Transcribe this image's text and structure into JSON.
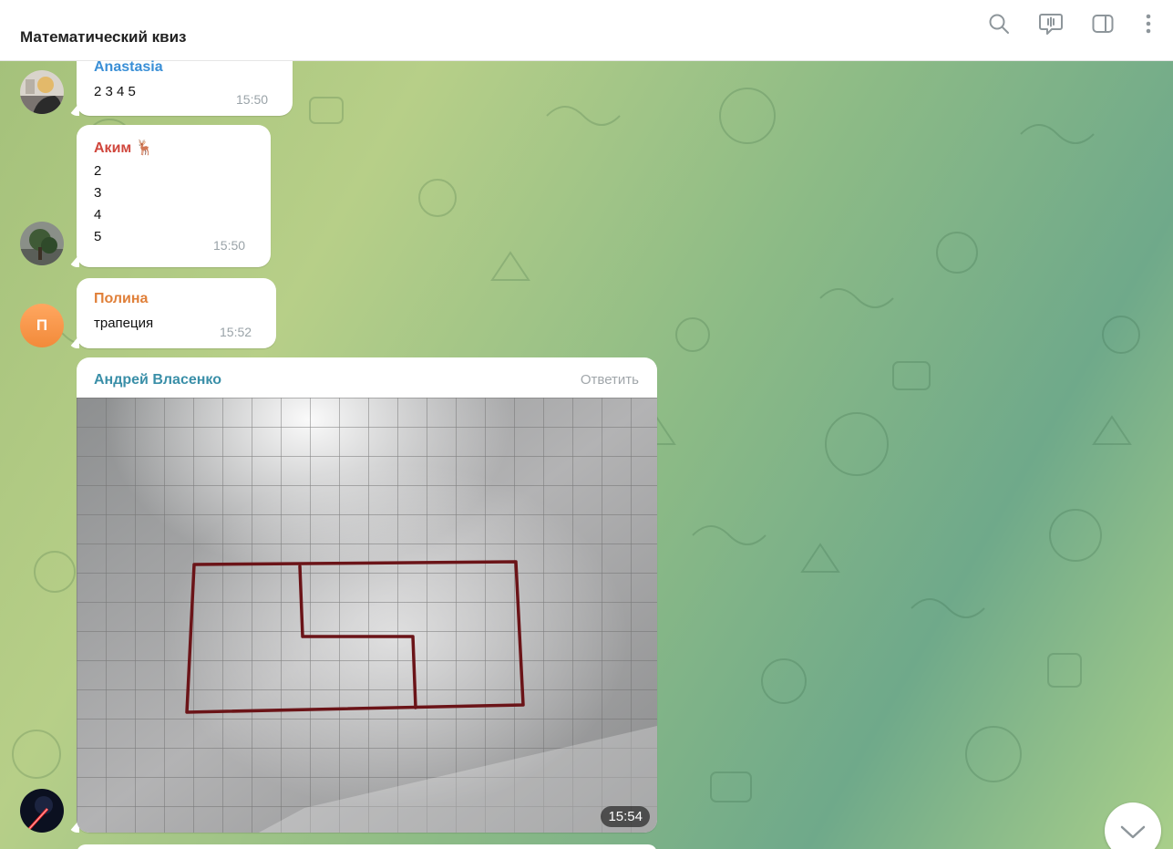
{
  "header": {
    "title": "Математический квиз",
    "icons": [
      "search-icon",
      "live-stream-icon",
      "sidebar-toggle-icon",
      "more-vertical-icon"
    ]
  },
  "messages": [
    {
      "sender": "Anastasia",
      "sender_color": "#3a8fd6",
      "lines": [
        "2 3 4 5"
      ],
      "time": "15:50"
    },
    {
      "sender": "Аким 🦌",
      "sender_color": "#d0463c",
      "lines": [
        "2",
        "3",
        "4",
        "5"
      ],
      "time": "15:50"
    },
    {
      "sender": "Полина",
      "sender_color": "#e0803a",
      "avatar_letter": "П",
      "lines": [
        "трапеция"
      ],
      "time": "15:52"
    },
    {
      "sender": "Андрей Власенко",
      "sender_color": "#3a8fa8",
      "reply_label": "Ответить",
      "photo": "grid-paper-drawing",
      "time": "15:54"
    }
  ],
  "colors": {
    "bubble_bg": "#ffffff",
    "time_text": "#9aa3a8",
    "header_bg": "#ffffff"
  }
}
